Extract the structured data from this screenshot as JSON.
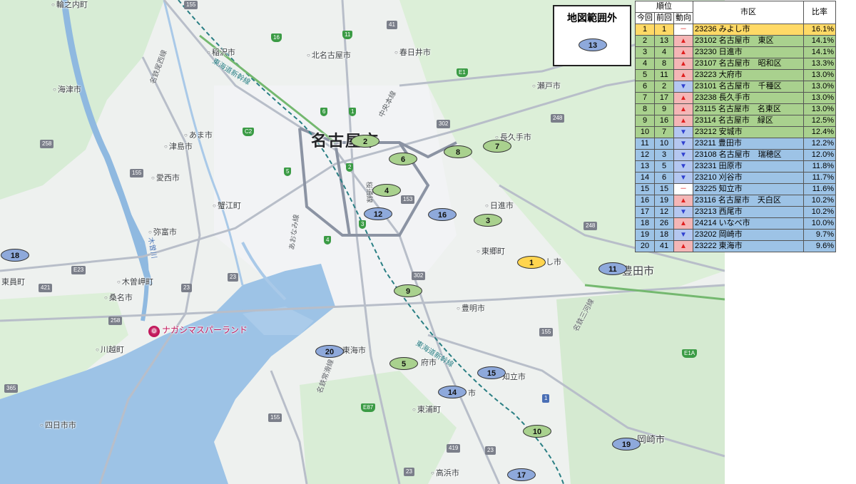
{
  "map": {
    "city_center_label": "名古屋市",
    "places": [
      {
        "id": "wakamiya",
        "text": "輪之内町"
      },
      {
        "id": "inazawa",
        "text": "稲沢市"
      },
      {
        "id": "kitanagoya",
        "text": "北名古屋市"
      },
      {
        "id": "kasugai",
        "text": "春日井市"
      },
      {
        "id": "kaizu",
        "text": "海津市"
      },
      {
        "id": "seto",
        "text": "瀬戸市"
      },
      {
        "id": "ama",
        "text": "あま市"
      },
      {
        "id": "tsushima",
        "text": "津島市"
      },
      {
        "id": "nagakute",
        "text": "長久手市"
      },
      {
        "id": "aisai",
        "text": "愛西市"
      },
      {
        "id": "kanie",
        "text": "蟹江町"
      },
      {
        "id": "nisshin",
        "text": "日進市"
      },
      {
        "id": "yatomi",
        "text": "弥富市"
      },
      {
        "id": "togo",
        "text": "東郷町"
      },
      {
        "id": "miyoshi",
        "text": "し市"
      },
      {
        "id": "toyota",
        "text": "豊田市"
      },
      {
        "id": "kisosaki",
        "text": "木曽岬町"
      },
      {
        "id": "higashiin",
        "text": "東員町"
      },
      {
        "id": "kuwana",
        "text": "桑名市"
      },
      {
        "id": "toyoake",
        "text": "豊明市"
      },
      {
        "id": "kawagoe",
        "text": "川越町"
      },
      {
        "id": "tokai",
        "text": "東海市"
      },
      {
        "id": "obu",
        "text": "府市"
      },
      {
        "id": "chiryu",
        "text": "知立市"
      },
      {
        "id": "kariya",
        "text": "市"
      },
      {
        "id": "higashiura",
        "text": "東浦町"
      },
      {
        "id": "yokkaichi",
        "text": "四日市市"
      },
      {
        "id": "okazaki",
        "text": "岡崎市"
      },
      {
        "id": "takahama",
        "text": "高浜市"
      }
    ],
    "poi": "ナガシマスパーランド",
    "rails": [
      {
        "id": "tokaido",
        "text": "東海道新幹線"
      },
      {
        "id": "tokaido2",
        "text": "東海道新幹線"
      },
      {
        "id": "meitetsu",
        "text": "名鉄尾西線"
      },
      {
        "id": "aonami",
        "text": "あおなみ線"
      },
      {
        "id": "meitetsu2",
        "text": "名鉄常滑線"
      },
      {
        "id": "sakuradori",
        "text": "桜通線"
      },
      {
        "id": "mikawa",
        "text": "名鉄三河線"
      },
      {
        "id": "chuo",
        "text": "中央本線"
      },
      {
        "id": "kisogawa",
        "text": "木曽川"
      }
    ],
    "roads": [
      "155",
      "16",
      "11",
      "41",
      "E1",
      "302",
      "248",
      "258",
      "C2",
      "5",
      "6",
      "1",
      "2",
      "155",
      "153",
      "4",
      "3",
      "248",
      "E23",
      "421",
      "23",
      "23",
      "258",
      "365",
      "302",
      "155",
      "1",
      "E1A",
      "E87",
      "155",
      "23",
      "419",
      "23"
    ],
    "markers": [
      {
        "rank": "1",
        "color": "yellow"
      },
      {
        "rank": "2",
        "color": "green"
      },
      {
        "rank": "3",
        "color": "green"
      },
      {
        "rank": "4",
        "color": "green"
      },
      {
        "rank": "5",
        "color": "green"
      },
      {
        "rank": "6",
        "color": "green"
      },
      {
        "rank": "7",
        "color": "green"
      },
      {
        "rank": "8",
        "color": "green"
      },
      {
        "rank": "9",
        "color": "green"
      },
      {
        "rank": "10",
        "color": "green"
      },
      {
        "rank": "11",
        "color": "blue"
      },
      {
        "rank": "12",
        "color": "blue"
      },
      {
        "rank": "14",
        "color": "blue"
      },
      {
        "rank": "15",
        "color": "blue"
      },
      {
        "rank": "16",
        "color": "blue"
      },
      {
        "rank": "17",
        "color": "blue"
      },
      {
        "rank": "18",
        "color": "blue"
      },
      {
        "rank": "19",
        "color": "blue"
      },
      {
        "rank": "20",
        "color": "blue"
      }
    ]
  },
  "out_of_range": {
    "title": "地図範囲外",
    "marker": "13"
  },
  "table": {
    "group_header": "順位",
    "headers": {
      "current": "今回",
      "previous": "前回",
      "trend": "動向",
      "city": "市区",
      "ratio": "比率"
    },
    "rows": [
      {
        "cur": "1",
        "prev": "1",
        "trend": "same",
        "city": "23236 みよし市",
        "ratio": "16.1%",
        "band": "yellow"
      },
      {
        "cur": "2",
        "prev": "13",
        "trend": "up",
        "city": "23102 名古屋市　東区",
        "ratio": "14.1%",
        "band": "green"
      },
      {
        "cur": "3",
        "prev": "4",
        "trend": "up",
        "city": "23230 日進市",
        "ratio": "14.1%",
        "band": "green"
      },
      {
        "cur": "4",
        "prev": "8",
        "trend": "up",
        "city": "23107 名古屋市　昭和区",
        "ratio": "13.3%",
        "band": "green"
      },
      {
        "cur": "5",
        "prev": "11",
        "trend": "up",
        "city": "23223 大府市",
        "ratio": "13.0%",
        "band": "green"
      },
      {
        "cur": "6",
        "prev": "2",
        "trend": "down",
        "city": "23101 名古屋市　千種区",
        "ratio": "13.0%",
        "band": "green"
      },
      {
        "cur": "7",
        "prev": "17",
        "trend": "up",
        "city": "23238 長久手市",
        "ratio": "13.0%",
        "band": "green"
      },
      {
        "cur": "8",
        "prev": "9",
        "trend": "up",
        "city": "23115 名古屋市　名東区",
        "ratio": "13.0%",
        "band": "green"
      },
      {
        "cur": "9",
        "prev": "16",
        "trend": "up",
        "city": "23114 名古屋市　緑区",
        "ratio": "12.5%",
        "band": "green"
      },
      {
        "cur": "10",
        "prev": "7",
        "trend": "down",
        "city": "23212 安城市",
        "ratio": "12.4%",
        "band": "green"
      },
      {
        "cur": "11",
        "prev": "10",
        "trend": "down",
        "city": "23211 豊田市",
        "ratio": "12.2%",
        "band": "blue"
      },
      {
        "cur": "12",
        "prev": "3",
        "trend": "down",
        "city": "23108 名古屋市　瑞穂区",
        "ratio": "12.0%",
        "band": "blue"
      },
      {
        "cur": "13",
        "prev": "5",
        "trend": "down",
        "city": "23231 田原市",
        "ratio": "11.8%",
        "band": "blue"
      },
      {
        "cur": "14",
        "prev": "6",
        "trend": "down",
        "city": "23210 刈谷市",
        "ratio": "11.7%",
        "band": "blue"
      },
      {
        "cur": "15",
        "prev": "15",
        "trend": "same",
        "city": "23225 知立市",
        "ratio": "11.6%",
        "band": "blue"
      },
      {
        "cur": "16",
        "prev": "19",
        "trend": "up",
        "city": "23116 名古屋市　天白区",
        "ratio": "10.2%",
        "band": "blue"
      },
      {
        "cur": "17",
        "prev": "12",
        "trend": "down",
        "city": "23213 西尾市",
        "ratio": "10.2%",
        "band": "blue"
      },
      {
        "cur": "18",
        "prev": "26",
        "trend": "up",
        "city": "24214 いなべ市",
        "ratio": "10.0%",
        "band": "blue"
      },
      {
        "cur": "19",
        "prev": "18",
        "trend": "down",
        "city": "23202 岡崎市",
        "ratio": "9.7%",
        "band": "blue"
      },
      {
        "cur": "20",
        "prev": "41",
        "trend": "up",
        "city": "23222 東海市",
        "ratio": "9.6%",
        "band": "blue"
      }
    ]
  },
  "colors": {
    "top": "#ffd966",
    "upper": "#a9d18e",
    "lower": "#9dc3e6",
    "up": "#e02020",
    "down": "#3040d0"
  }
}
